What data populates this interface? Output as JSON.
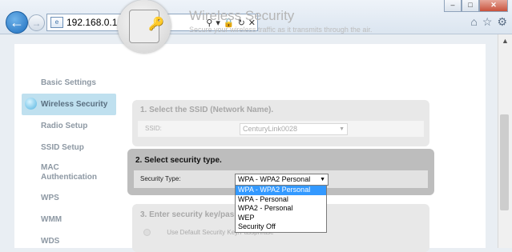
{
  "browser": {
    "url": "192.168.0.1",
    "window_buttons": {
      "minimize": "–",
      "maximize": "□",
      "close": "✕"
    }
  },
  "header": {
    "title": "Wireless Security",
    "subtitle": "Secure your wireless traffic as it transmits through the air."
  },
  "sidebar": {
    "items": [
      {
        "label": "Basic Settings",
        "active": false
      },
      {
        "label": "Wireless Security",
        "active": true
      },
      {
        "label": "Radio Setup",
        "active": false
      },
      {
        "label": "SSID Setup",
        "active": false
      },
      {
        "label": "MAC Authentication",
        "active": false
      },
      {
        "label": "WPS",
        "active": false
      },
      {
        "label": "WMM",
        "active": false
      },
      {
        "label": "WDS",
        "active": false
      }
    ]
  },
  "section1": {
    "heading": "1. Select the SSID (Network Name).",
    "label": "SSID:",
    "value": "CenturyLink0028"
  },
  "section2": {
    "heading": "2. Select security type.",
    "label": "Security Type:",
    "value": "WPA - WPA2 Personal",
    "options": [
      "WPA - WPA2 Personal",
      "WPA - Personal",
      "WPA2 - Personal",
      "WEP",
      "Security Off"
    ],
    "selected_index": 0
  },
  "section3": {
    "heading": "3. Enter security key/passphrase.",
    "option_label": "Use Default Security Key/Passphrase"
  },
  "colors": {
    "accent": "#3399ff",
    "active_sidebar": "#bfe0ef"
  }
}
